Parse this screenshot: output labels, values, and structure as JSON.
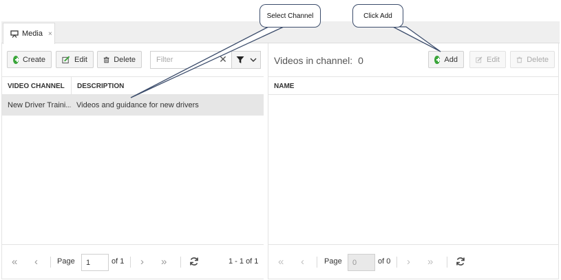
{
  "tab": {
    "label": "Media",
    "close": "×"
  },
  "left": {
    "toolbar": {
      "create": "Create",
      "edit": "Edit",
      "delete": "Delete",
      "filter_placeholder": "Filter",
      "clear": "✕"
    },
    "columns": [
      "VIDEO CHANNEL",
      "DESCRIPTION"
    ],
    "rows": [
      {
        "channel": "New Driver Traini...",
        "description": "Videos and guidance for new drivers"
      }
    ],
    "pager": {
      "page_label": "Page",
      "page_value": "1",
      "of_label": "of 1",
      "range": "1 - 1 of 1"
    }
  },
  "right": {
    "title": "Videos in channel:",
    "count": "0",
    "toolbar": {
      "add": "Add",
      "edit": "Edit",
      "delete": "Delete"
    },
    "columns": [
      "NAME"
    ],
    "pager": {
      "page_label": "Page",
      "page_value": "0",
      "of_label": "of 0"
    }
  },
  "callouts": {
    "select_channel": "Select Channel",
    "click_add": "Click Add"
  },
  "icons": {
    "tab": "presentation-icon",
    "create": "plus-circle-icon",
    "edit": "edit-icon",
    "delete": "trash-icon",
    "filter": "funnel-icon",
    "dropdown": "chevron-down-icon",
    "first": "double-chevron-left-icon",
    "prev": "chevron-left-icon",
    "next": "chevron-right-icon",
    "last": "double-chevron-right-icon",
    "refresh": "refresh-icon"
  },
  "colors": {
    "accent_green": "#3aa53a",
    "selected_row": "#e6e6e6",
    "callout_border": "#3b4c6b"
  }
}
